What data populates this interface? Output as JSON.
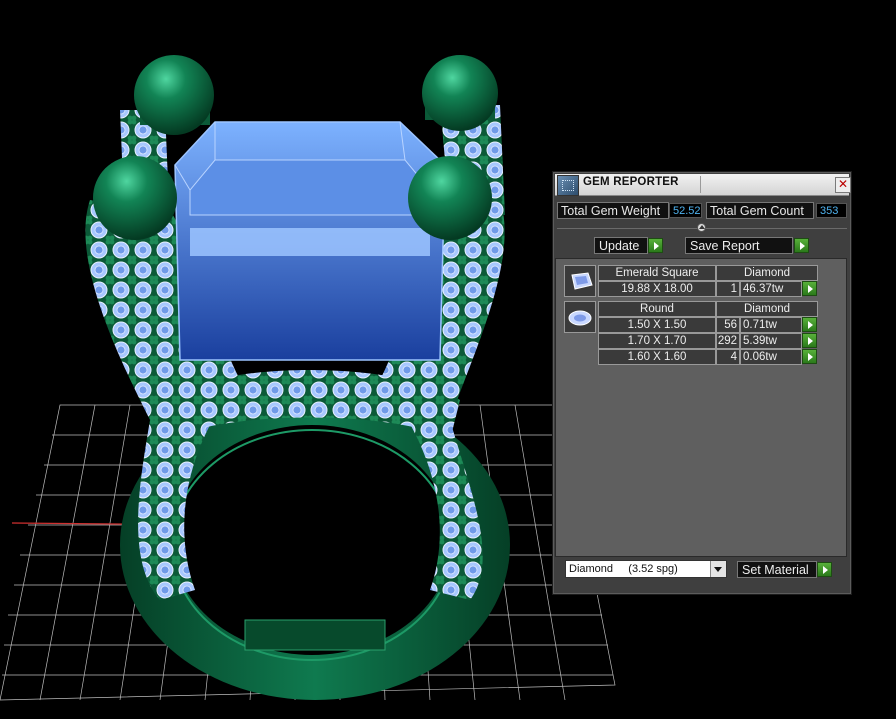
{
  "window": {
    "title": "GEM REPORTER",
    "close_glyph": "✕"
  },
  "stats": {
    "total_weight_label": "Total Gem Weight",
    "total_weight_value": "52.52",
    "total_count_label": "Total Gem Count",
    "total_count_value": "353"
  },
  "toolbar": {
    "update_label": "Update",
    "save_report_label": "Save Report"
  },
  "groups": [
    {
      "icon": "emerald-cut-gem-icon",
      "shape": "Emerald Square",
      "material": "Diamond",
      "rows": [
        {
          "size": "19.88 X 18.00",
          "count": "1",
          "weight": "46.37tw"
        }
      ]
    },
    {
      "icon": "round-gem-icon",
      "shape": "Round",
      "material": "Diamond",
      "rows": [
        {
          "size": "1.50 X 1.50",
          "count": "56",
          "weight": "0.71tw"
        },
        {
          "size": "1.70 X 1.70",
          "count": "292",
          "weight": "5.39tw"
        },
        {
          "size": "1.60 X 1.60",
          "count": "4",
          "weight": "0.06tw"
        }
      ]
    }
  ],
  "footer": {
    "material_selected": "Diamond     (3.52 spg)",
    "set_material_label": "Set Material"
  },
  "colors": {
    "ring_metal": "#0d6b45",
    "gem_blue": "#6fa8ff",
    "grid": "#cfcfcf",
    "accent_value": "#4fb3f0"
  }
}
